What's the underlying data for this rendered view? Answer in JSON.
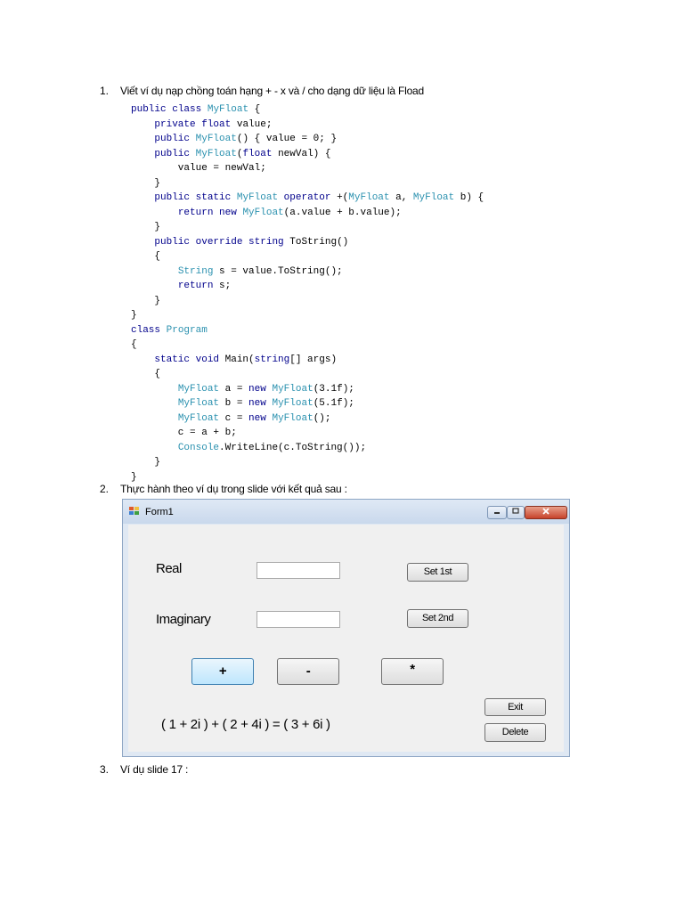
{
  "items": [
    {
      "num": "1.",
      "text": "Viết ví dụ nạp chồng toán hạng + - x và / cho dạng dữ liệu là Fload"
    },
    {
      "num": "2.",
      "text": "Thực hành theo ví dụ trong slide với kết quả sau :"
    },
    {
      "num": "3.",
      "text": "Ví dụ slide 17 :"
    }
  ],
  "code_lines": [
    "public class MyFloat {",
    "    private float value;",
    "    public MyFloat() { value = 0; }",
    "    public MyFloat(float newVal) {",
    "        value = newVal;",
    "    }",
    "    public static MyFloat operator +(MyFloat a, MyFloat b) {",
    "        return new MyFloat(a.value + b.value);",
    "    }",
    "    public override string ToString()",
    "    {",
    "        String s = value.ToString();",
    "        return s;",
    "    }",
    "}",
    "class Program",
    "{",
    "    static void Main(string[] args)",
    "    {",
    "        MyFloat a = new MyFloat(3.1f);",
    "        MyFloat b = new MyFloat(5.1f);",
    "        MyFloat c = new MyFloat();",
    "        c = a + b;",
    "        Console.WriteLine(c.ToString());",
    "    }",
    "}"
  ],
  "form": {
    "title": "Form1",
    "real_label": "Real",
    "imaginary_label": "Imaginary",
    "real_value": "",
    "imaginary_value": "",
    "set1_label": "Set 1st",
    "set2_label": "Set 2nd",
    "plus_label": "+",
    "minus_label": "-",
    "mult_label": "*",
    "exit_label": "Exit",
    "delete_label": "Delete",
    "result_text": "( 1 + 2i ) + ( 2 + 4i ) = ( 3 + 6i )",
    "controls": {
      "minimize": "minimize-icon",
      "maximize": "maximize-icon",
      "close": "close-icon"
    }
  },
  "colors": {
    "keyword": "#00008b",
    "type": "#2b91af",
    "window_border": "#8ea6c4",
    "client_bg": "#f0f0f0"
  }
}
